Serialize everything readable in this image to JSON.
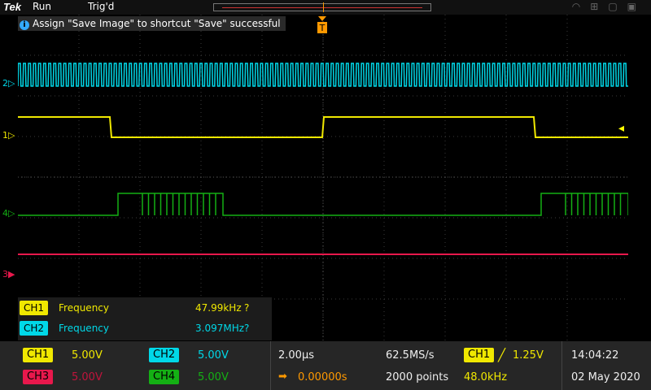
{
  "topbar": {
    "logo": "Tek",
    "run": "Run",
    "trigger_state": "Trig'd"
  },
  "notice": {
    "text": "Assign \"Save Image\" to shortcut \"Save\" successful"
  },
  "channels": {
    "ch1": {
      "label": "CH1",
      "scale": "5.00V",
      "color": "#f0e800",
      "marker": "1"
    },
    "ch2": {
      "label": "CH2",
      "scale": "5.00V",
      "color": "#00d8e8",
      "marker": "2"
    },
    "ch3": {
      "label": "CH3",
      "scale": "5.00V",
      "color": "#e8184c",
      "marker": "3"
    },
    "ch4": {
      "label": "CH4",
      "scale": "5.00V",
      "color": "#14b014",
      "marker": "4"
    }
  },
  "measurements": [
    {
      "channel": "CH1",
      "name": "Frequency",
      "value": "47.99kHz",
      "flag": "?"
    },
    {
      "channel": "CH2",
      "name": "Frequency",
      "value": "3.097MHz",
      "flag": "?"
    }
  ],
  "horizontal": {
    "scale": "2.00µs",
    "position": "0.00000s",
    "sample_rate": "62.5MS/s",
    "record_length": "2000 points"
  },
  "trigger": {
    "source": "CH1",
    "level": "1.25V",
    "frequency": "48.0kHz",
    "marker_letter": "T"
  },
  "clock": {
    "time": "14:04:22",
    "date": "02 May 2020"
  }
}
